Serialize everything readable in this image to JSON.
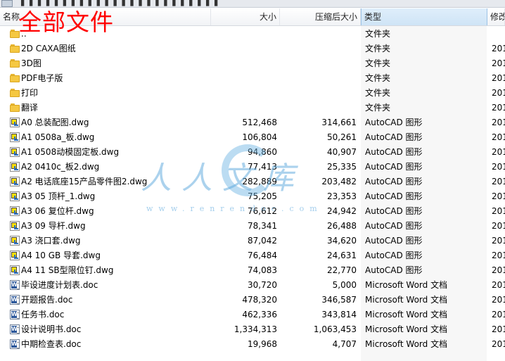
{
  "window": {
    "breadcrumb": "▌ ▌ ▌ ▌ ▌ ▌ ▌ ▌ ▌ ▌ ▌ ▌ ▌ ▌ ▌ ▌ ▌ ▌ ▌ ▌ ▌ ▌ ▌ ▌"
  },
  "overlay_title": "全部文件",
  "columns": {
    "name": "名称",
    "size": "大小",
    "compressed": "压缩后大小",
    "type": "类型",
    "modified": "修改"
  },
  "watermark": {
    "text": "人人文库",
    "url": "www.renrendoc.com"
  },
  "files": [
    {
      "icon": "folder-icon",
      "name": "..",
      "size": "",
      "compressed": "",
      "type": "文件夹",
      "date": ""
    },
    {
      "icon": "folder-icon",
      "name": "2D CAXA图纸",
      "size": "",
      "compressed": "",
      "type": "文件夹",
      "date": "201"
    },
    {
      "icon": "folder-icon",
      "name": "3D图",
      "size": "",
      "compressed": "",
      "type": "文件夹",
      "date": "201"
    },
    {
      "icon": "folder-icon",
      "name": "PDF电子版",
      "size": "",
      "compressed": "",
      "type": "文件夹",
      "date": "201"
    },
    {
      "icon": "folder-icon",
      "name": "打印",
      "size": "",
      "compressed": "",
      "type": "文件夹",
      "date": "201"
    },
    {
      "icon": "folder-icon",
      "name": "翻译",
      "size": "",
      "compressed": "",
      "type": "文件夹",
      "date": "201"
    },
    {
      "icon": "dwg-icon",
      "name": "A0 总装配图.dwg",
      "size": "512,468",
      "compressed": "314,661",
      "type": "AutoCAD 图形",
      "date": "201"
    },
    {
      "icon": "dwg-icon",
      "name": "A1 0508a_板.dwg",
      "size": "106,804",
      "compressed": "50,261",
      "type": "AutoCAD 图形",
      "date": "201"
    },
    {
      "icon": "dwg-icon",
      "name": "A1 0508动模固定板.dwg",
      "size": "94,860",
      "compressed": "40,907",
      "type": "AutoCAD 图形",
      "date": "201"
    },
    {
      "icon": "dwg-icon",
      "name": "A2 0410c_板2.dwg",
      "size": "77,413",
      "compressed": "25,335",
      "type": "AutoCAD 图形",
      "date": "201"
    },
    {
      "icon": "dwg-icon",
      "name": "A2 电话底座15产品零件图2.dwg",
      "size": "282,889",
      "compressed": "203,482",
      "type": "AutoCAD 图形",
      "date": "201"
    },
    {
      "icon": "dwg-icon",
      "name": "A3 05 顶杆_1.dwg",
      "size": "75,205",
      "compressed": "23,353",
      "type": "AutoCAD 图形",
      "date": "201"
    },
    {
      "icon": "dwg-icon",
      "name": "A3 06 复位杆.dwg",
      "size": "76,612",
      "compressed": "24,942",
      "type": "AutoCAD 图形",
      "date": "201"
    },
    {
      "icon": "dwg-icon",
      "name": "A3 09 导杆.dwg",
      "size": "78,341",
      "compressed": "26,488",
      "type": "AutoCAD 图形",
      "date": "201"
    },
    {
      "icon": "dwg-icon",
      "name": "A3 浇口套.dwg",
      "size": "87,042",
      "compressed": "34,620",
      "type": "AutoCAD 图形",
      "date": "201"
    },
    {
      "icon": "dwg-icon",
      "name": "A4 10 GB 导套.dwg",
      "size": "76,484",
      "compressed": "24,631",
      "type": "AutoCAD 图形",
      "date": "201"
    },
    {
      "icon": "dwg-icon",
      "name": "A4 11 SB型限位钉.dwg",
      "size": "74,083",
      "compressed": "22,770",
      "type": "AutoCAD 图形",
      "date": "201"
    },
    {
      "icon": "doc-icon",
      "name": "毕设进度计划表.doc",
      "size": "30,720",
      "compressed": "5,000",
      "type": "Microsoft Word 文档",
      "date": "201"
    },
    {
      "icon": "doc-icon",
      "name": "开题报告.doc",
      "size": "478,320",
      "compressed": "346,587",
      "type": "Microsoft Word 文档",
      "date": "201"
    },
    {
      "icon": "doc-icon",
      "name": "任务书.doc",
      "size": "462,336",
      "compressed": "343,814",
      "type": "Microsoft Word 文档",
      "date": "201"
    },
    {
      "icon": "doc-icon",
      "name": "设计说明书.doc",
      "size": "1,334,313",
      "compressed": "1,063,453",
      "type": "Microsoft Word 文档",
      "date": "201"
    },
    {
      "icon": "doc-icon",
      "name": "中期检查表.doc",
      "size": "19,968",
      "compressed": "4,707",
      "type": "Microsoft Word 文档",
      "date": "201"
    }
  ]
}
